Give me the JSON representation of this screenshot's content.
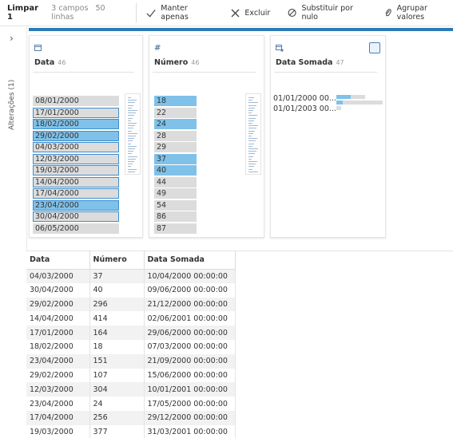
{
  "toolbar": {
    "title": "Limpar 1",
    "fields": "3 campos",
    "rows": "50 linhas",
    "buttons": {
      "keep_only": "Manter apenas",
      "exclude": "Excluir",
      "replace_null": "Substituir por nulo",
      "group_values": "Agrupar valores"
    }
  },
  "sidebar": {
    "changes_label": "Alterações (1)"
  },
  "cards": {
    "data": {
      "name": "Data",
      "count": "46",
      "bars": [
        "08/01/2000",
        "17/01/2000",
        "18/02/2000",
        "29/02/2000",
        "04/03/2000",
        "12/03/2000",
        "19/03/2000",
        "14/04/2000",
        "17/04/2000",
        "23/04/2000",
        "30/04/2000",
        "06/05/2000"
      ]
    },
    "numero": {
      "name": "Número",
      "count": "46",
      "bars": [
        "18",
        "22",
        "24",
        "28",
        "29",
        "37",
        "40",
        "44",
        "49",
        "54",
        "86",
        "87"
      ]
    },
    "data_somada": {
      "name": "Data Somada",
      "count": "47",
      "items": [
        "01/01/2000 00...",
        "01/01/2003 00..."
      ]
    }
  },
  "table": {
    "headers": [
      "Data",
      "Número",
      "Data Somada"
    ],
    "rows": [
      [
        "04/03/2000",
        "37",
        "10/04/2000 00:00:00"
      ],
      [
        "30/04/2000",
        "40",
        "09/06/2000 00:00:00"
      ],
      [
        "29/02/2000",
        "296",
        "21/12/2000 00:00:00"
      ],
      [
        "14/04/2000",
        "414",
        "02/06/2001 00:00:00"
      ],
      [
        "17/01/2000",
        "164",
        "29/06/2000 00:00:00"
      ],
      [
        "18/02/2000",
        "18",
        "07/03/2000 00:00:00"
      ],
      [
        "23/04/2000",
        "151",
        "21/09/2000 00:00:00"
      ],
      [
        "29/02/2000",
        "107",
        "15/06/2000 00:00:00"
      ],
      [
        "12/03/2000",
        "304",
        "10/01/2001 00:00:00"
      ],
      [
        "23/04/2000",
        "24",
        "17/05/2000 00:00:00"
      ],
      [
        "17/04/2000",
        "256",
        "29/12/2000 00:00:00"
      ],
      [
        "19/03/2000",
        "377",
        "31/03/2001 00:00:00"
      ]
    ]
  },
  "colors": {
    "accent": "#2d7bb5",
    "selected": "#7fc1e8",
    "bar": "#dcdcdc"
  }
}
